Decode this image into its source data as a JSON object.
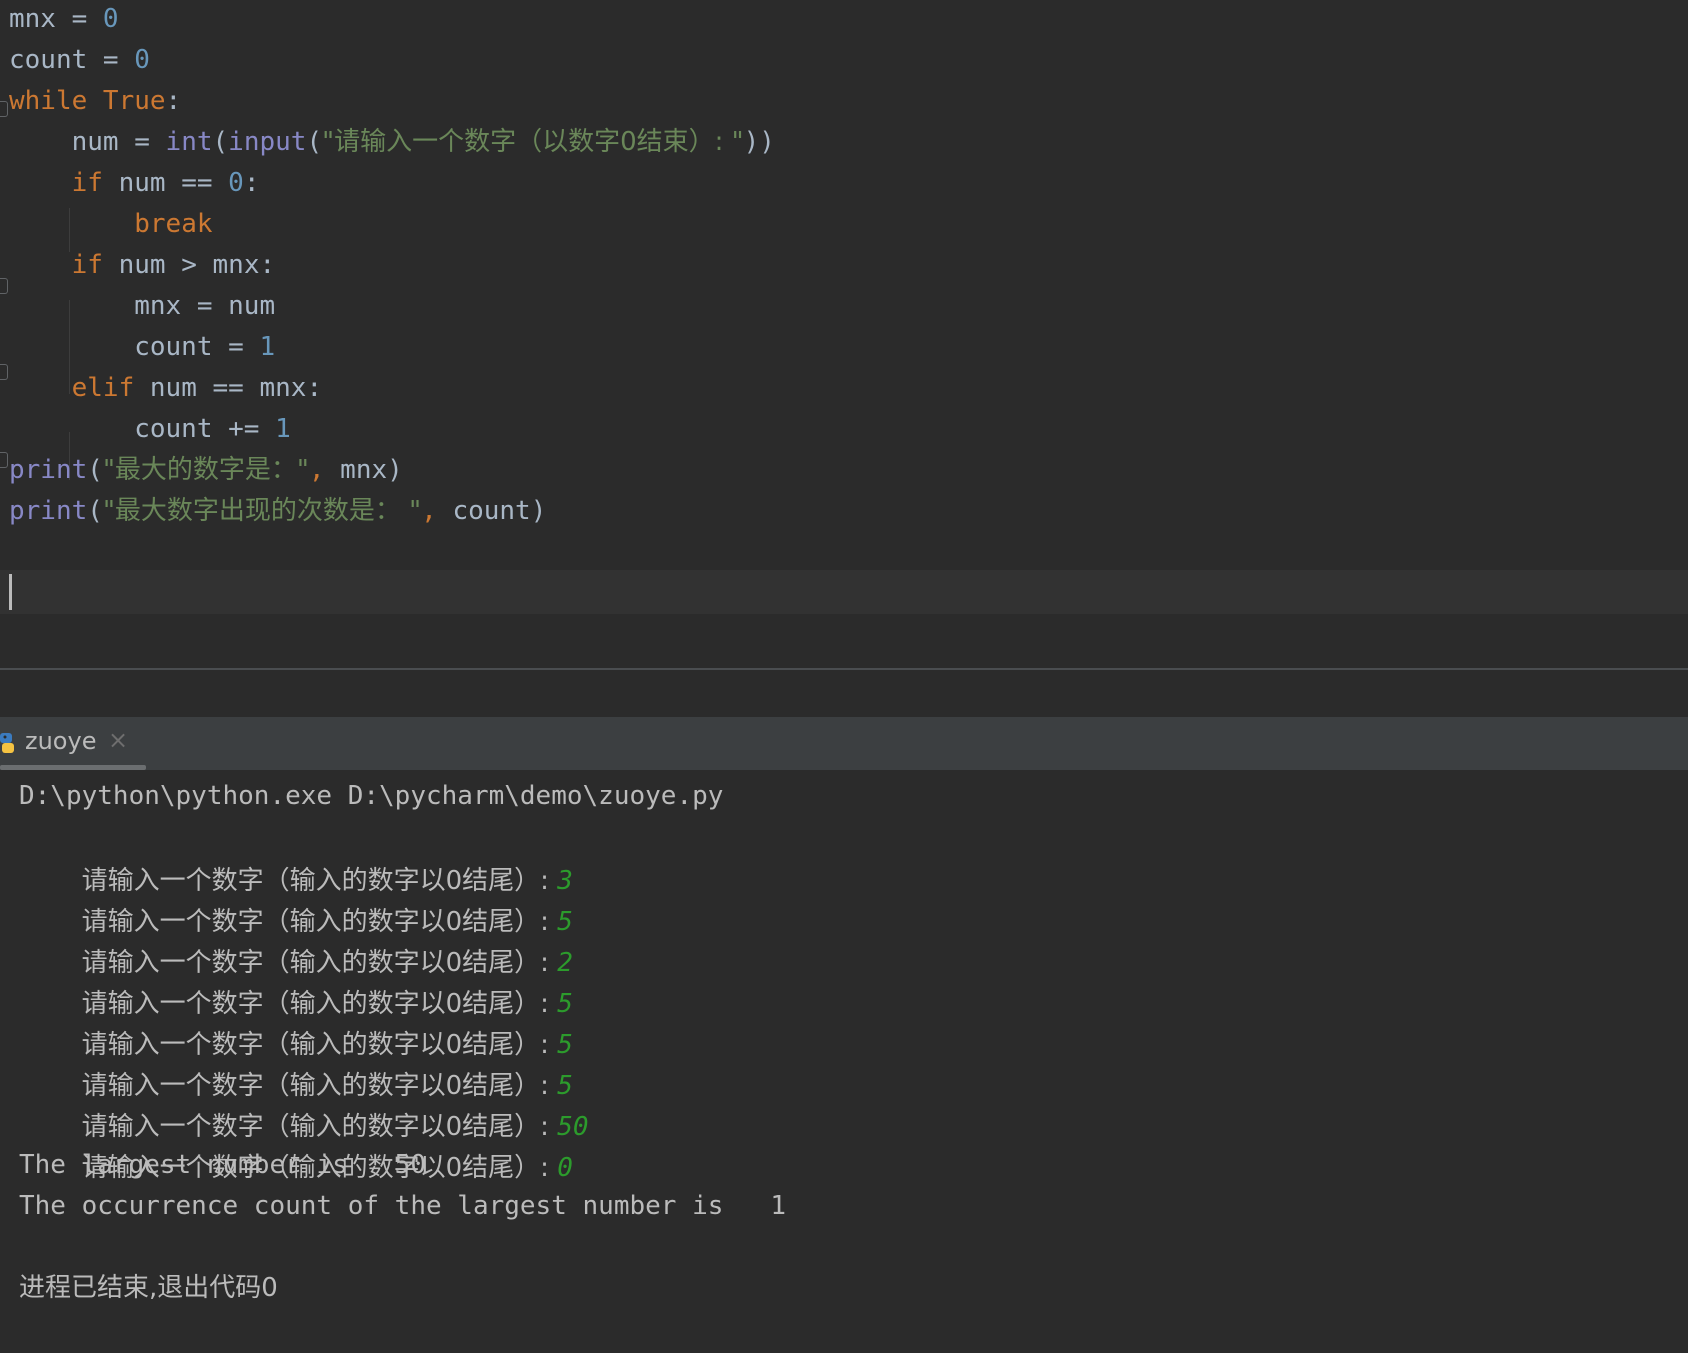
{
  "editor": {
    "lines": [
      [
        {
          "t": "mnx = ",
          "c": "id"
        },
        {
          "t": "0",
          "c": "num"
        }
      ],
      [
        {
          "t": "count = ",
          "c": "id"
        },
        {
          "t": "0",
          "c": "num"
        }
      ],
      [
        {
          "t": "while ",
          "c": "kw"
        },
        {
          "t": "True",
          "c": "kw"
        },
        {
          "t": ":",
          "c": "id"
        }
      ],
      [
        {
          "t": "    num = ",
          "c": "id"
        },
        {
          "t": "int",
          "c": "bi"
        },
        {
          "t": "(",
          "c": "id"
        },
        {
          "t": "input",
          "c": "bi"
        },
        {
          "t": "(",
          "c": "id"
        },
        {
          "t": "\"请输入一个数字（以数字0结束）: \"",
          "c": "str"
        },
        {
          "t": "))",
          "c": "id"
        }
      ],
      [
        {
          "t": "    ",
          "c": "id"
        },
        {
          "t": "if ",
          "c": "kw"
        },
        {
          "t": "num == ",
          "c": "id"
        },
        {
          "t": "0",
          "c": "num"
        },
        {
          "t": ":",
          "c": "id"
        }
      ],
      [
        {
          "t": "        ",
          "c": "id"
        },
        {
          "t": "break",
          "c": "kw"
        }
      ],
      [
        {
          "t": "    ",
          "c": "id"
        },
        {
          "t": "if ",
          "c": "kw"
        },
        {
          "t": "num > mnx:",
          "c": "id"
        }
      ],
      [
        {
          "t": "        mnx = num",
          "c": "id"
        }
      ],
      [
        {
          "t": "        count = ",
          "c": "id"
        },
        {
          "t": "1",
          "c": "num"
        }
      ],
      [
        {
          "t": "    ",
          "c": "id"
        },
        {
          "t": "elif ",
          "c": "kw"
        },
        {
          "t": "num == mnx:",
          "c": "id"
        }
      ],
      [
        {
          "t": "        count += ",
          "c": "id"
        },
        {
          "t": "1",
          "c": "num"
        }
      ],
      [
        {
          "t": "print",
          "c": "bi"
        },
        {
          "t": "(",
          "c": "id"
        },
        {
          "t": "\"最大的数字是：\"",
          "c": "str"
        },
        {
          "t": ", ",
          "c": "kw"
        },
        {
          "t": "mnx)",
          "c": "id"
        }
      ],
      [
        {
          "t": "print",
          "c": "bi"
        },
        {
          "t": "(",
          "c": "id"
        },
        {
          "t": "\"最大数字出现的次数是： \"",
          "c": "str"
        },
        {
          "t": ", ",
          "c": "kw"
        },
        {
          "t": "count)",
          "c": "id"
        }
      ],
      []
    ]
  },
  "run_tab": {
    "label": "zuoye",
    "close_glyph": "×"
  },
  "console": {
    "command": "D:\\python\\python.exe D:\\pycharm\\demo\\zuoye.py",
    "prompt": "请输入一个数字（输入的数字以0结尾）: ",
    "inputs": [
      "3",
      "5",
      "2",
      "5",
      "5",
      "5",
      "50",
      "0"
    ],
    "result_line_1": "The largest number is   50",
    "result_line_2": "The occurrence count of the largest number is   1",
    "exit_message": "进程已结束,退出代码0"
  },
  "colors": {
    "background": "#2b2b2b",
    "keyword": "#cc7832",
    "number": "#6897bb",
    "string": "#6a8759",
    "builtin": "#8888c6",
    "identifier": "#a9b7c6",
    "console_text": "#bbbbbb",
    "user_input": "#2c9b2c"
  }
}
